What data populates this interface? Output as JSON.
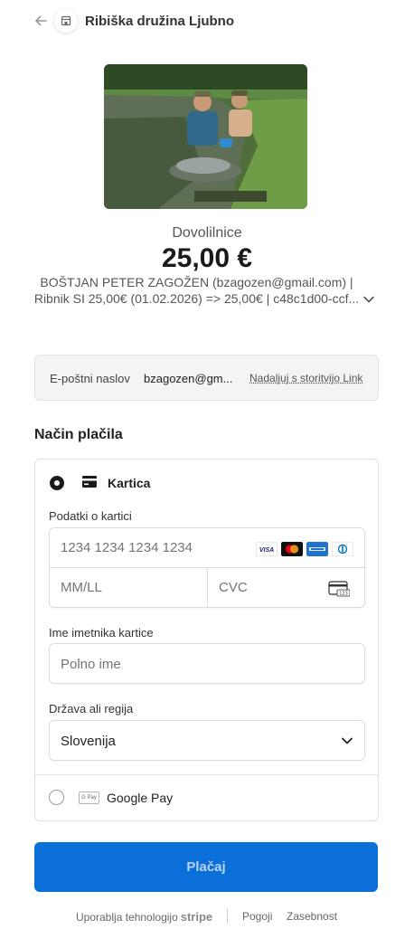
{
  "header": {
    "merchant_name": "Ribiška družina Ljubno"
  },
  "product": {
    "name": "Dovolilnice",
    "price": "25,00 €",
    "description_line1": "BOŠTJAN PETER ZAGOŽEN (bzagozen@gmail.com) |",
    "description_line2": "Ribnik SI 25,00€ (01.02.2026) => 25,00€ | c48c1d00-ccf..."
  },
  "link": {
    "label": "E-poštni naslov",
    "email": "bzagozen@gm...",
    "continue_label": "Nadaljuj s storitvijo Link"
  },
  "payment": {
    "section_title": "Način plačila",
    "card_tab_label": "Kartica",
    "card_info_label": "Podatki o kartici",
    "card_number_placeholder": "1234 1234 1234 1234",
    "expiry_placeholder": "MM/LL",
    "cvc_placeholder": "CVC",
    "cardholder_label": "Ime imetnika kartice",
    "cardholder_placeholder": "Polno ime",
    "country_label": "Država ali regija",
    "country_value": "Slovenija",
    "google_pay_label": "Google Pay",
    "google_pay_icon_text": "G Pay",
    "card_brands": [
      "visa-icon",
      "mastercard-icon",
      "amex-icon",
      "diners-icon"
    ]
  },
  "pay_button_label": "Plačaj",
  "footer": {
    "powered_by": "Uporablja tehnologijo",
    "stripe": "stripe",
    "terms": "Pogoji",
    "privacy": "Zasebnost"
  },
  "colors": {
    "accent": "#0a6fd9",
    "pay_button_text": "#b9d3f2"
  }
}
